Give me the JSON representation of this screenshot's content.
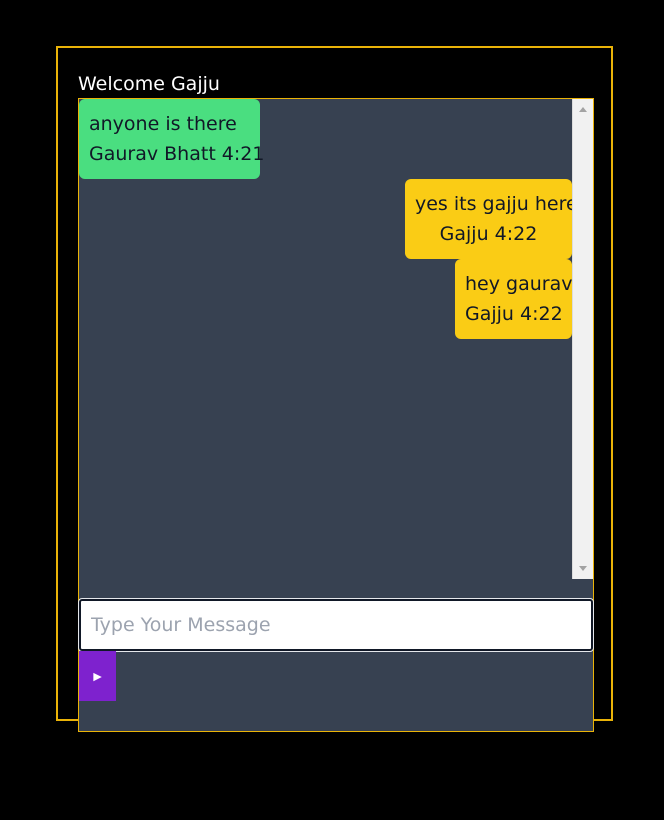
{
  "header": {
    "welcome": "Welcome Gajju"
  },
  "messages": [
    {
      "text": "anyone is there",
      "meta": "Gaurav Bhatt  4:21",
      "side": "incoming"
    },
    {
      "text": "yes its gajju here",
      "meta": "Gajju  4:22",
      "side": "outgoing"
    },
    {
      "text": "hey gaurav",
      "meta": "Gajju  4:22",
      "side": "outgoing"
    }
  ],
  "composer": {
    "placeholder": "Type Your Message",
    "value": "",
    "send_icon": "►"
  },
  "colors": {
    "frame_border": "#eab308",
    "panel_bg": "#374151",
    "incoming_bubble": "#4ade80",
    "outgoing_bubble": "#facc15",
    "send_button": "#7e22ce"
  }
}
